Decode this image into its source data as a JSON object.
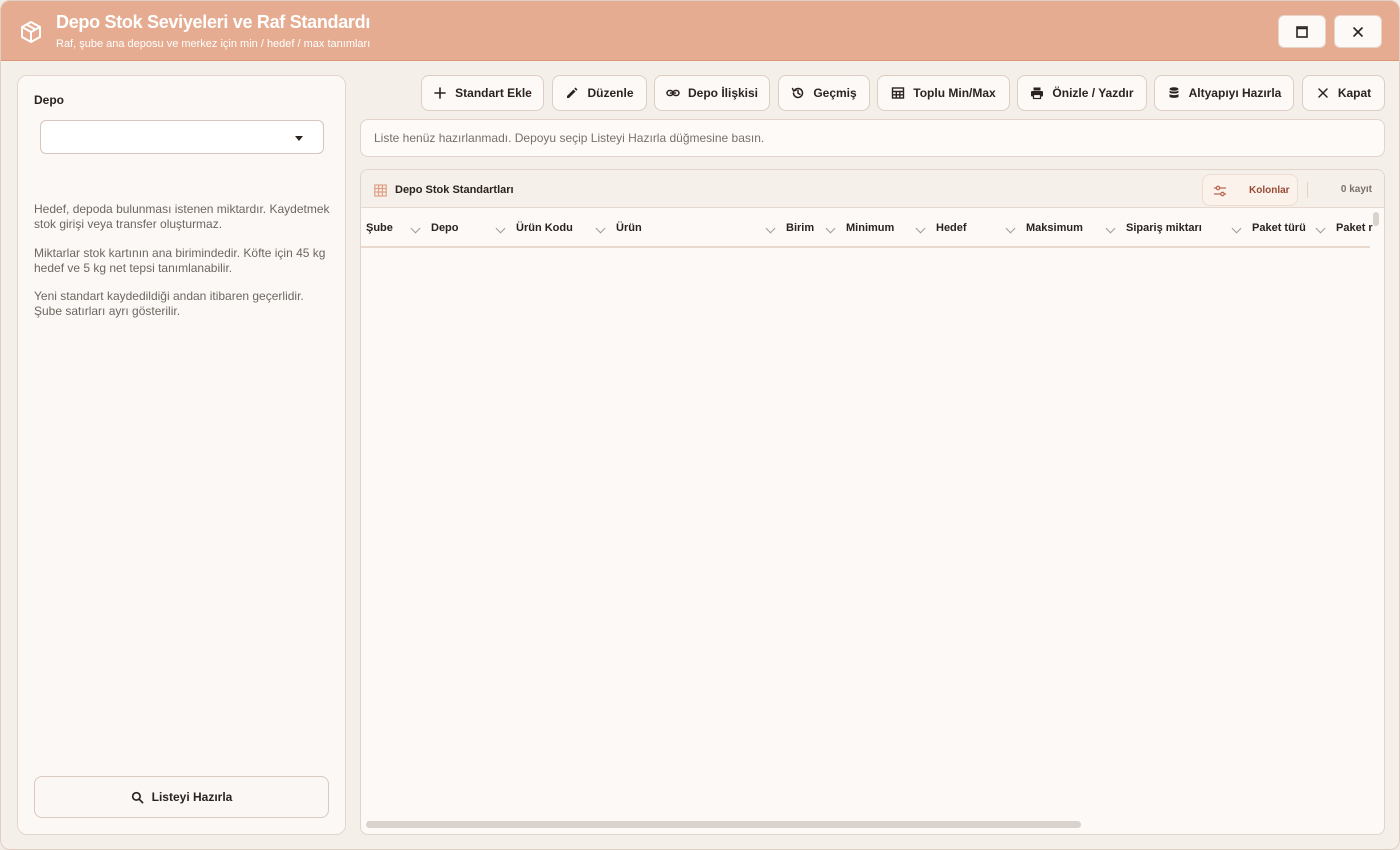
{
  "window": {
    "title": "Depo Stok Seviyeleri ve Raf Standardı",
    "subtitle": "Raf, şube ana deposu ve merkez için min / hedef / max tanımları",
    "controls": [
      "maximize-icon",
      "close-icon"
    ]
  },
  "sidebar": {
    "depo_label": "Depo",
    "depo_selected": "",
    "help": [
      "Hedef, depoda bulunması istenen miktardır. Kaydetmek stok girişi veya transfer oluşturmaz.",
      "Miktarlar stok kartının ana birimindedir. Köfte için 45 kg hedef ve 5 kg net tepsi tanımlanabilir.",
      "Yeni standart kaydedildiği andan itibaren geçerlidir. Şube satırları ayrı gösterilir."
    ],
    "prepare_button": "Listeyi Hazırla"
  },
  "toolbar": {
    "add": "Standart Ekle",
    "edit": "Düzenle",
    "relation": "Depo İlişkisi",
    "history": "Geçmiş",
    "bulk": "Toplu Min/Max",
    "print": "Önizle / Yazdır",
    "infra": "Altyapıyı Hazırla",
    "close": "Kapat"
  },
  "info_message": "Liste henüz hazırlanmadı. Depoyu seçip Listeyi Hazırla düğmesine basın.",
  "grid": {
    "title": "Depo Stok Standartları",
    "columns_button": "Kolonlar",
    "record_count": "0 kayıt",
    "columns": [
      "Şube",
      "Depo",
      "Ürün Kodu",
      "Ürün",
      "Birim",
      "Minimum",
      "Hedef",
      "Maksimum",
      "Sipariş miktarı",
      "Paket türü",
      "Paket r"
    ],
    "rows": []
  },
  "colors": {
    "titlebar": "#e5ac91",
    "accent_text": "#9a4a35",
    "background": "#f5efea"
  }
}
